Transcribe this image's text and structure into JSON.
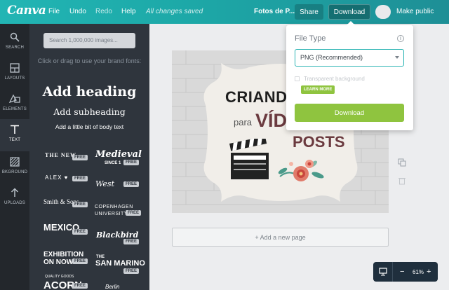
{
  "app": {
    "logo": "Canva",
    "menu": [
      "File",
      "Undo",
      "Redo",
      "Help"
    ],
    "status": "All changes saved",
    "doc_title": "Fotos de P...",
    "share_label": "Share",
    "download_label": "Download",
    "make_public_label": "Make public"
  },
  "rail": {
    "items": [
      {
        "label": "SEARCH",
        "icon": "search-icon"
      },
      {
        "label": "LAYOUTS",
        "icon": "layouts-icon"
      },
      {
        "label": "ELEMENTS",
        "icon": "elements-icon"
      },
      {
        "label": "TEXT",
        "icon": "text-icon",
        "active": true
      },
      {
        "label": "BKGROUND",
        "icon": "background-icon"
      },
      {
        "label": "UPLOADS",
        "icon": "upload-icon"
      }
    ]
  },
  "panel": {
    "search_placeholder": "Search 1,000,000 images...",
    "hint": "Click or drag to use your brand fonts:",
    "add_heading": "Add heading",
    "add_subheading": "Add subheading",
    "add_body": "Add a little bit of body text",
    "free_badge": "FREE",
    "font_combos": [
      {
        "main": "THE NEW"
      },
      {
        "main": "Medieval",
        "sub": "SINCE 1"
      },
      {
        "main": "ALEX ♥"
      },
      {
        "main": "West"
      },
      {
        "main": "Smith & Sons"
      },
      {
        "main": "COPENHAGEN",
        "sub": "UNIVERSITY"
      },
      {
        "main": "MEXICO"
      },
      {
        "main": "Blackbird"
      },
      {
        "main": "EXHIBITION",
        "sub": "ON NOW"
      },
      {
        "main": "THE",
        "sub": "SAN MARINO"
      },
      {
        "main": "ACORN",
        "sub": "QUALITY GOODS"
      },
      {
        "main": "Berlin"
      }
    ]
  },
  "canvas": {
    "design_text": [
      "CRIANDO",
      "para",
      "VÍDE",
      "POSTS"
    ],
    "add_page": "+ Add a new page"
  },
  "zoom": {
    "value": "61%",
    "minus": "−",
    "plus": "+"
  },
  "download_menu": {
    "title": "File Type",
    "selected_type": "PNG (Recommended)",
    "transparent_label": "Transparent background",
    "learn_more": "LEARN MORE",
    "download_button": "Download"
  },
  "colors": {
    "topbar": "#22b5b4",
    "panel": "#2f353d",
    "rail": "#23272c",
    "accent_green": "#8fc43f",
    "design_maroon": "#6b3a3f"
  }
}
